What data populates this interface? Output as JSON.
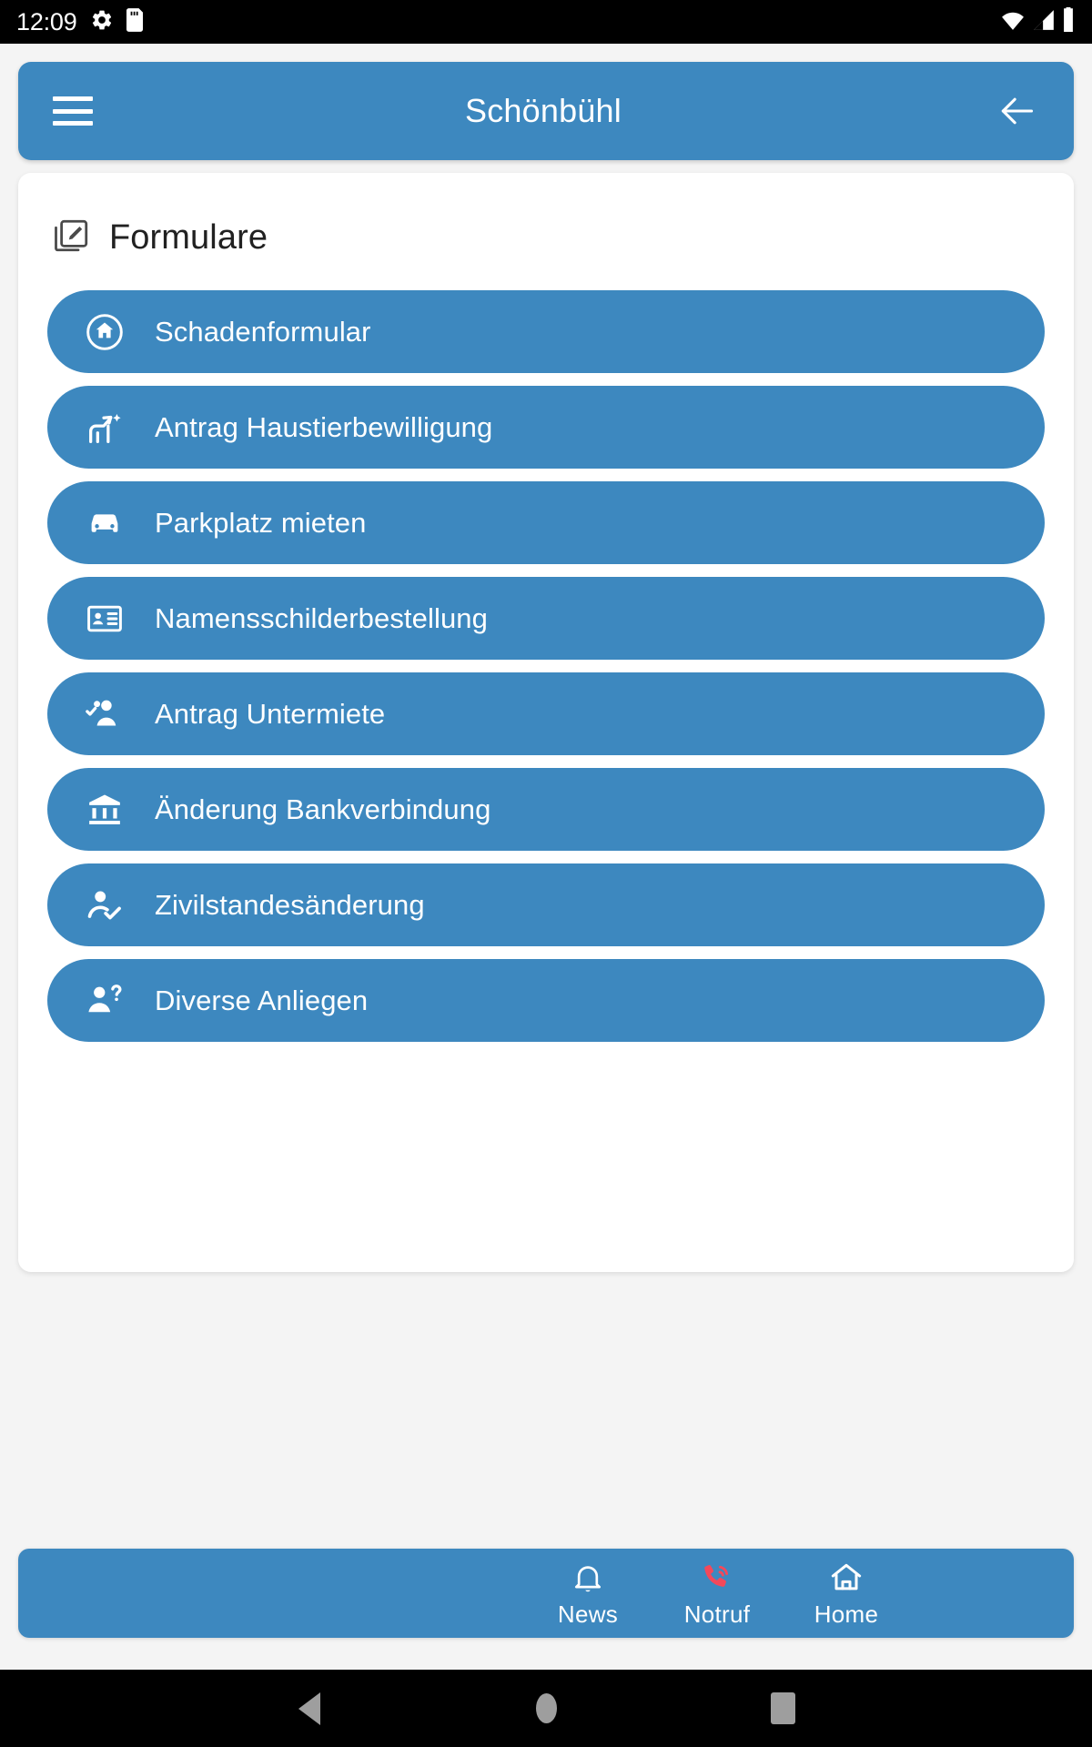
{
  "status_bar": {
    "time": "12:09",
    "left_icons": [
      "gear-icon",
      "sd-card-icon"
    ],
    "right_icons": [
      "wifi-icon",
      "signal-icon",
      "battery-icon"
    ]
  },
  "header": {
    "title": "Schönbühl",
    "menu_icon": "hamburger-menu-icon",
    "back_icon": "arrow-left-icon",
    "background_color": "#3D88BF"
  },
  "section": {
    "title": "Formulare",
    "icon": "edit-square-icon"
  },
  "forms": [
    {
      "label": "Schadenformular",
      "icon": "home-circle-icon"
    },
    {
      "label": "Antrag Haustierbewilligung",
      "icon": "pets-dog-icon"
    },
    {
      "label": "Parkplatz mieten",
      "icon": "car-icon"
    },
    {
      "label": "Namensschilderbestellung",
      "icon": "id-badge-icon"
    },
    {
      "label": "Antrag Untermiete",
      "icon": "group-check-icon"
    },
    {
      "label": "Änderung Bankverbindung",
      "icon": "bank-icon"
    },
    {
      "label": "Zivilstandesänderung",
      "icon": "person-check-icon"
    },
    {
      "label": "Diverse Anliegen",
      "icon": "person-question-icon"
    }
  ],
  "bottom_nav": {
    "items": [
      {
        "label": "News",
        "icon": "bell-icon",
        "color": "#ffffff"
      },
      {
        "label": "Notruf",
        "icon": "phone-call-icon",
        "color": "#F4485A"
      },
      {
        "label": "Home",
        "icon": "house-icon",
        "color": "#ffffff"
      }
    ]
  },
  "system_nav": {
    "back": "back-triangle-icon",
    "home": "home-circle-icon",
    "recents": "recents-square-icon"
  },
  "theme": {
    "accent": "#3D88BF",
    "page_background": "#f4f4f4",
    "card_background": "#ffffff",
    "emergency_red": "#F4485A"
  }
}
